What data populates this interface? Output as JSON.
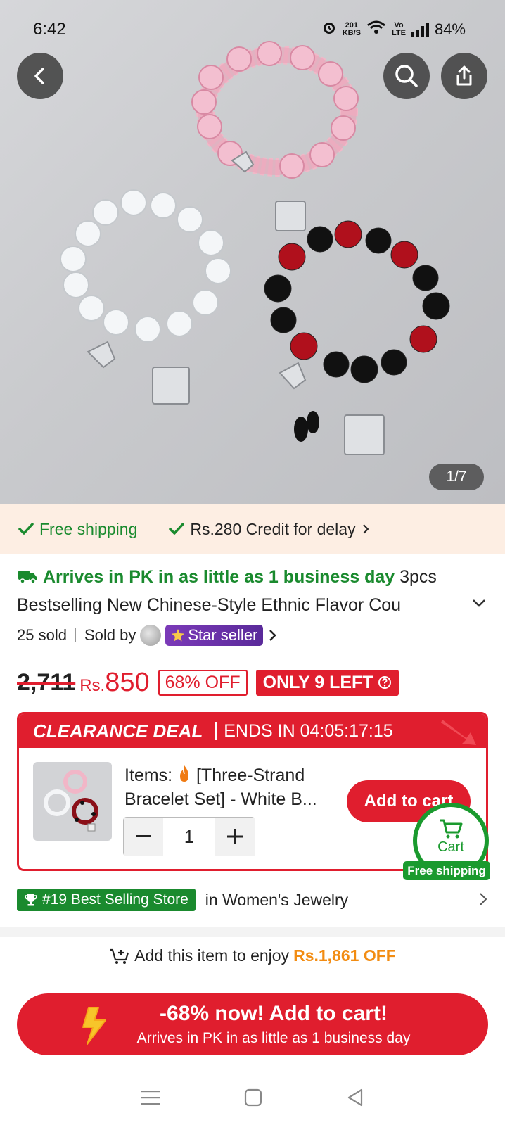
{
  "status_bar": {
    "time": "6:42",
    "net_speed_value": "201",
    "net_speed_unit": "KB/S",
    "volte_top": "Vo",
    "volte_bottom": "LTE",
    "battery": "84%"
  },
  "hero": {
    "image_counter": "1/7",
    "icons": [
      "back-icon",
      "search-icon",
      "share-icon"
    ]
  },
  "shipping_banner": {
    "free_shipping": "Free shipping",
    "credit": "Rs.280 Credit for delay"
  },
  "product": {
    "arrives": "Arrives in PK in as little as 1 business day",
    "title_start": "3pcs",
    "title_line2": "Bestselling New Chinese-Style Ethnic Flavor Cou",
    "sold": "25 sold",
    "sold_by": "Sold by",
    "star_seller": "Star seller",
    "old_price": "2,711",
    "currency": "Rs.",
    "price": "850",
    "discount": "68% OFF",
    "stock": "ONLY 9 LEFT"
  },
  "clearance": {
    "label": "CLEARANCE DEAL",
    "ends_in": "ENDS IN 04:05:17:15",
    "items_prefix": "Items:",
    "item_name_l1": "[Three-Strand",
    "item_name_l2": "Bracelet Set] - White B...",
    "quantity": "1",
    "add_to_cart": "Add to cart"
  },
  "cart_fab": {
    "label": "Cart",
    "tag": "Free shipping"
  },
  "store": {
    "badge": "#19 Best Selling Store",
    "category": "in Women's Jewelry"
  },
  "promo": {
    "prefix": "Add this item to enjoy",
    "amount": "Rs.1,861 OFF"
  },
  "cta": {
    "line1": "-68% now! Add to cart!",
    "line2": "Arrives in PK in as little as 1 business day"
  },
  "colors": {
    "brand_red": "#e01e2e",
    "green": "#1a8a2e",
    "orange": "#f28c12",
    "banner_bg": "#fdeee3"
  }
}
